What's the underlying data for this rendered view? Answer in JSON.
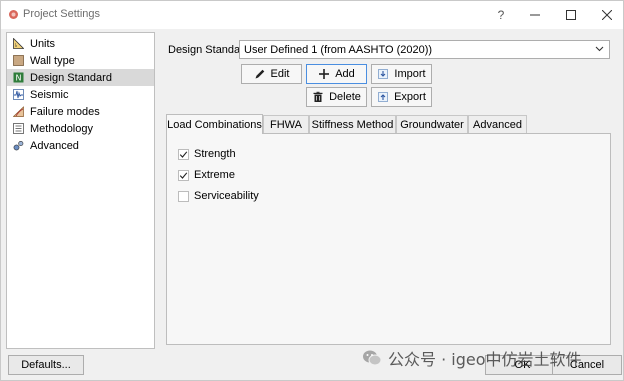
{
  "window": {
    "title": "Project Settings"
  },
  "titlebar": {
    "help": "?",
    "minimize_icon": "minimize-icon",
    "maximize_icon": "maximize-icon",
    "close_icon": "close-icon"
  },
  "nav": {
    "items": [
      {
        "label": "Units",
        "icon": "ruler-icon",
        "selected": false
      },
      {
        "label": "Wall type",
        "icon": "wall-icon",
        "selected": false
      },
      {
        "label": "Design Standard",
        "icon": "standard-icon",
        "selected": true
      },
      {
        "label": "Seismic",
        "icon": "seismic-icon",
        "selected": false
      },
      {
        "label": "Failure modes",
        "icon": "failure-modes-icon",
        "selected": false
      },
      {
        "label": "Methodology",
        "icon": "methodology-icon",
        "selected": false
      },
      {
        "label": "Advanced",
        "icon": "advanced-icon",
        "selected": false
      }
    ]
  },
  "footer": {
    "defaults": "Defaults...",
    "ok": "OK",
    "cancel": "Cancel"
  },
  "design_standard": {
    "label": "Design Standard:",
    "selected": "User Defined 1 (from AASHTO (2020))",
    "buttons": {
      "edit": "Edit",
      "add": "Add",
      "import": "Import",
      "delete": "Delete",
      "export": "Export"
    }
  },
  "tabs": [
    {
      "label": "Load Combinations",
      "active": true
    },
    {
      "label": "FHWA",
      "active": false
    },
    {
      "label": "Stiffness Method",
      "active": false
    },
    {
      "label": "Groundwater",
      "active": false
    },
    {
      "label": "Advanced",
      "active": false
    }
  ],
  "load_combinations": [
    {
      "label": "Strength",
      "checked": true
    },
    {
      "label": "Extreme",
      "checked": true
    },
    {
      "label": "Serviceability",
      "checked": false
    }
  ],
  "watermark": {
    "text": "公众号 · igeo中仿岩土软件"
  },
  "colors": {
    "selection": "#d9d9d9",
    "focus_border": "#4a8ee0",
    "panel": "#f7f7f7",
    "window": "#f0f0f0"
  }
}
